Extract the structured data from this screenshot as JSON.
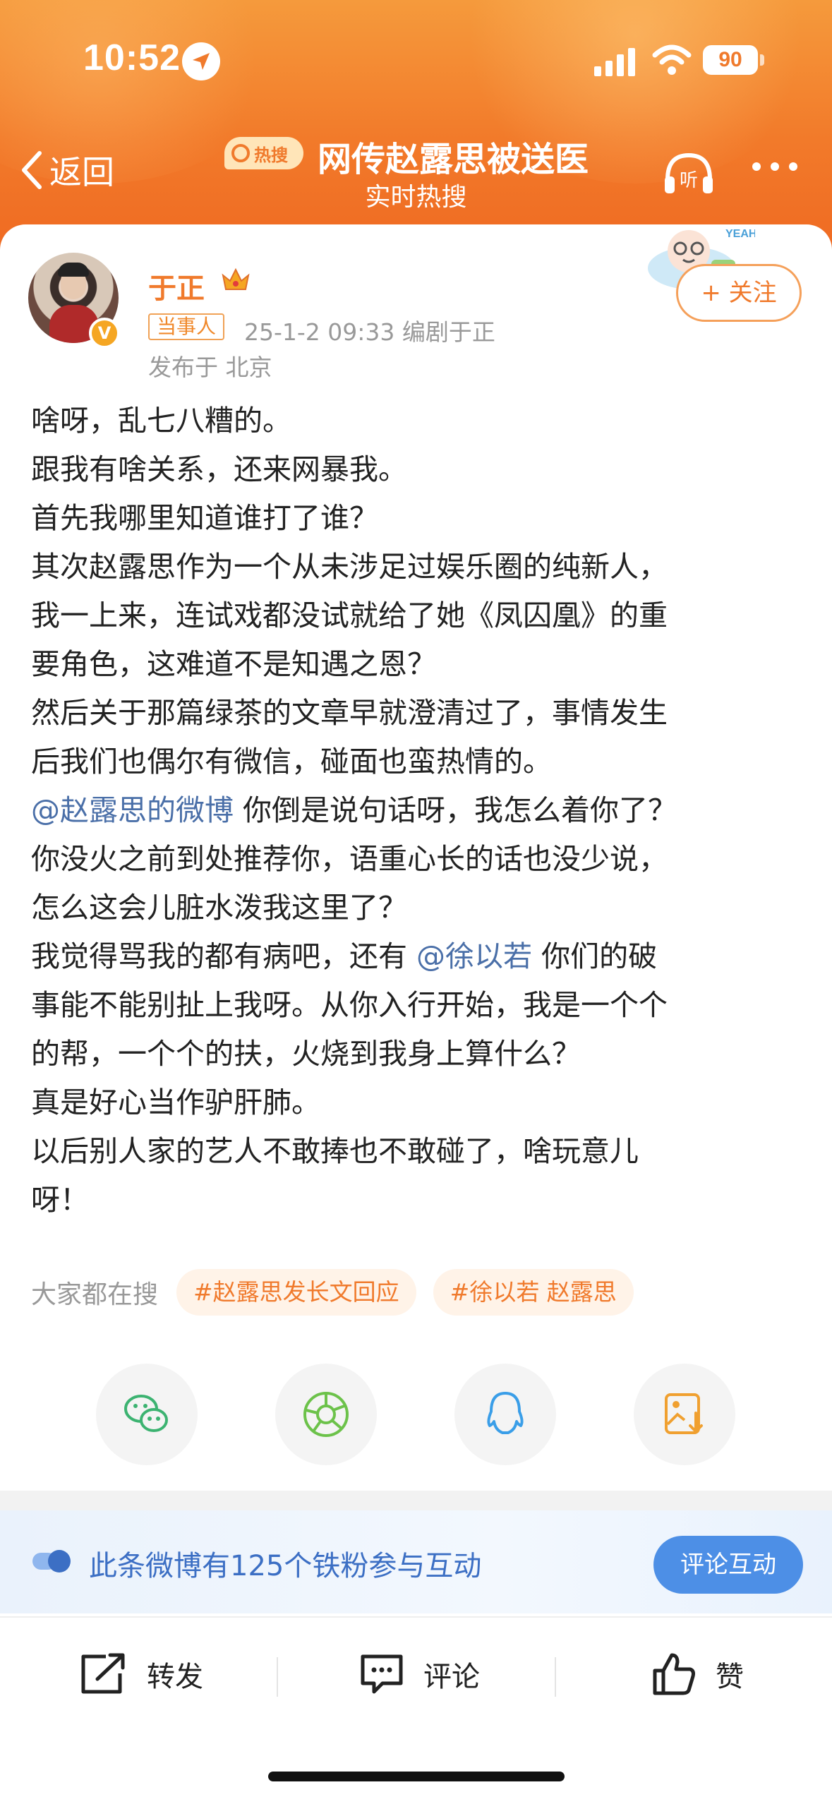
{
  "status_bar": {
    "time": "10:52",
    "battery": "90"
  },
  "nav": {
    "back_label": "返回",
    "hot_badge": "热搜",
    "title": "网传赵露思被送医",
    "subtitle": "实时热搜",
    "listen_label": "听"
  },
  "post": {
    "author": "于正",
    "role_tag": "当事人",
    "meta": "25-1-2 09:33  编剧于正",
    "location": "发布于 北京",
    "follow_label": "+ 关注",
    "sticker_text": "YEAH!",
    "verified_mark": "V",
    "lines": [
      "啥呀，乱七八糟的。",
      "跟我有啥关系，还来网暴我。",
      "首先我哪里知道谁打了谁？",
      "其次赵露思作为一个从未涉足过娱乐圈的纯新人，",
      "我一上来，连试戏都没试就给了她《凤囚凰》的重",
      "要角色，这难道不是知遇之恩？",
      "然后关于那篇绿茶的文章早就澄清过了，事情发生",
      "后我们也偶尔有微信，碰面也蛮热情的。",
      "你没火之前到处推荐你，语重心长的话也没少说，",
      "怎么这会儿脏水泼我这里了？",
      "事能不能别扯上我呀。从你入行开始，我是一个个",
      "的帮，一个个的扶，火烧到我身上算什么？",
      "真是好心当作驴肝肺。",
      "以后别人家的艺人不敢捧也不敢碰了，啥玩意儿",
      "呀！"
    ],
    "mention_line_1": {
      "mention": "@赵露思的微博",
      "rest": " 你倒是说句话呀，我怎么着你了？"
    },
    "mention_line_2": {
      "before": "我觉得骂我的都有病吧，还有 ",
      "mention": "@徐以若",
      "after": " 你们的破"
    }
  },
  "search": {
    "label": "大家都在搜",
    "tags": [
      "#赵露思发长文回应",
      "#徐以若 赵露思"
    ]
  },
  "share_icons": [
    "wechat-icon",
    "moments-icon",
    "qq-icon",
    "save-image-icon"
  ],
  "fans_banner": {
    "text": "此条微博有125个铁粉参与互动",
    "button": "评论互动"
  },
  "actions": {
    "repost": "转发",
    "comment": "评论",
    "like": "赞"
  },
  "colors": {
    "accent": "#f07a2c",
    "mention": "#4a6fa8",
    "banner_blue": "#4d8fe6"
  }
}
